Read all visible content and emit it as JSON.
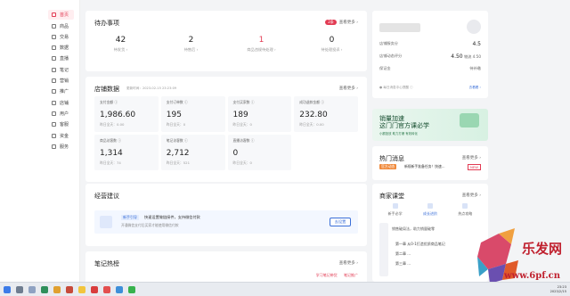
{
  "sidebar": {
    "items": [
      {
        "label": "首页",
        "icon": "home-icon",
        "active": true
      },
      {
        "label": "商品",
        "icon": "goods-icon"
      },
      {
        "label": "交易",
        "icon": "trade-icon"
      },
      {
        "label": "数据",
        "icon": "data-icon"
      },
      {
        "label": "直播",
        "icon": "live-icon"
      },
      {
        "label": "笔记",
        "icon": "note-icon"
      },
      {
        "label": "营销",
        "icon": "marketing-icon"
      },
      {
        "label": "推广",
        "icon": "promotion-icon"
      },
      {
        "label": "店铺",
        "icon": "shop-icon"
      },
      {
        "label": "用户",
        "icon": "user-icon"
      },
      {
        "label": "客服",
        "icon": "service-icon"
      },
      {
        "label": "资金",
        "icon": "funds-icon"
      },
      {
        "label": "服务",
        "icon": "service-market-icon"
      }
    ]
  },
  "todo": {
    "title": "待办事项",
    "badge": "2条",
    "link": "查看更多 ›",
    "items": [
      {
        "value": "42",
        "label": "待发货 ›",
        "red": false
      },
      {
        "value": "2",
        "label": "待售后 ›",
        "red": false
      },
      {
        "value": "1",
        "label": "商品违规待处理 ›",
        "red": true
      },
      {
        "value": "0",
        "label": "待处理投诉 ›",
        "red": false
      }
    ]
  },
  "shop_data": {
    "title": "店铺数据",
    "updated": "更新时间：2023-02-15 23:23:09",
    "link": "查看更多 ›",
    "metrics": [
      {
        "label": "支付金额 ⓘ",
        "value": "1,986.60",
        "sub": "昨日全天：0.00"
      },
      {
        "label": "支付订单数 ⓘ",
        "value": "195",
        "sub": "昨日全天：0"
      },
      {
        "label": "支付买家数 ⓘ",
        "value": "189",
        "sub": "昨日全天：0"
      },
      {
        "label": "成功退款金额 ⓘ",
        "value": "232.80",
        "sub": "昨日全天：0.00"
      },
      {
        "label": "商品访客数 ⓘ",
        "value": "1,314",
        "sub": "昨日全天：74"
      },
      {
        "label": "笔记访客数 ⓘ",
        "value": "2,712",
        "sub": "昨日全天：521"
      },
      {
        "label": "直播访客数 ⓘ",
        "value": "0",
        "sub": "昨日全天：0"
      }
    ]
  },
  "biz": {
    "title": "经营建议",
    "tag": "新手引导",
    "headline": "快速设置做链接件，支持微信付款",
    "desc": "开通微信支付后买家才能使用微信付款",
    "button": "去设置"
  },
  "notes": {
    "title": "笔记热榜",
    "link": "查看更多 ›",
    "links": [
      "学习笔记带货",
      "笔记推广"
    ]
  },
  "shop_info": {
    "rows": [
      {
        "label": "店铺服务分",
        "value": "4.5",
        "extra": ""
      },
      {
        "label": "店铺动态评分",
        "value": "4.50",
        "extra": "物流 4.50"
      },
      {
        "label": "保证金",
        "value": "",
        "extra": "待补缴"
      }
    ],
    "alert": "● 每日消息中心提醒 ⓘ",
    "alert_link": "去看看 ›"
  },
  "banner": {
    "line1": "销量加速",
    "line2": "这门门官方课必学",
    "line3": "小额投放 助力打爆 有效转化"
  },
  "hot": {
    "title": "热门消息",
    "link": "查看更多 ›",
    "tag": "官方动态",
    "text": "新规新手准备任务！快速…",
    "badge": "NEW"
  },
  "school": {
    "title": "商家课堂",
    "link": "查看更多 ›",
    "tabs": [
      "新手必学",
      "成长进阶",
      "热点攻略"
    ],
    "sub": "销售破局法，助力销量破零",
    "list": [
      "第一章 从0-1打造优质商品笔记",
      "第二章 ...",
      "第三章 ..."
    ]
  },
  "watermark": {
    "name": "乐发网",
    "url": "www.6pf.cn"
  },
  "taskbar": {
    "time": "23:23",
    "date": "2023/2/15"
  }
}
